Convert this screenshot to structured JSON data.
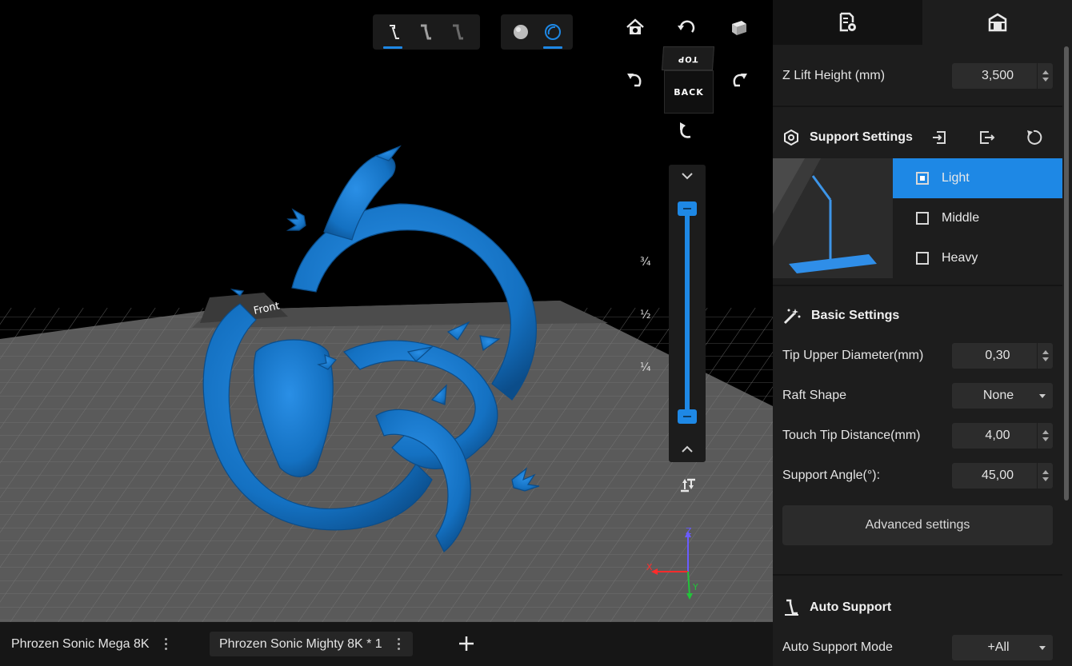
{
  "toolbar": {
    "views": [
      "view-support-light",
      "view-support-middle",
      "view-support-heavy"
    ],
    "render_modes": [
      "solid-shading",
      "xray-shading"
    ],
    "nav": {
      "cube_top": "TOP",
      "cube_back": "BACK"
    }
  },
  "layer_slider": {
    "marks": [
      "¾",
      "½",
      "¼"
    ],
    "lower": 0.0,
    "upper": 1.0
  },
  "panel": {
    "tabs": [
      "file-settings",
      "support-settings"
    ],
    "z_lift": {
      "label": "Z Lift Height (mm)",
      "value": "3,500"
    },
    "support_settings": {
      "title": "Support Settings",
      "options": [
        {
          "label": "Light",
          "selected": true
        },
        {
          "label": "Middle",
          "selected": false
        },
        {
          "label": "Heavy",
          "selected": false
        }
      ]
    },
    "basic_settings": {
      "title": "Basic Settings",
      "tip_upper": {
        "label": "Tip Upper Diameter(mm)",
        "value": "0,30"
      },
      "raft_shape": {
        "label": "Raft Shape",
        "value": "None"
      },
      "touch_tip": {
        "label": "Touch Tip Distance(mm)",
        "value": "4,00"
      },
      "support_angle": {
        "label": "Support Angle(°):",
        "value": "45,00"
      },
      "advanced_button": "Advanced settings"
    },
    "auto_support": {
      "title": "Auto Support",
      "mode": {
        "label": "Auto Support Mode",
        "value": "+All"
      }
    }
  },
  "bottom_tabs": [
    {
      "label": "Phrozen Sonic Mega 8K",
      "active": false
    },
    {
      "label": "Phrozen Sonic Mighty 8K * 1",
      "active": true
    }
  ],
  "build_plate_label": "Front",
  "axes": {
    "x": "X",
    "y": "Y",
    "z": "Z"
  },
  "colors": {
    "accent": "#1e88e5",
    "model": "#1474c8",
    "panel": "#1d1d1d",
    "plate": "#5e5e5e"
  }
}
